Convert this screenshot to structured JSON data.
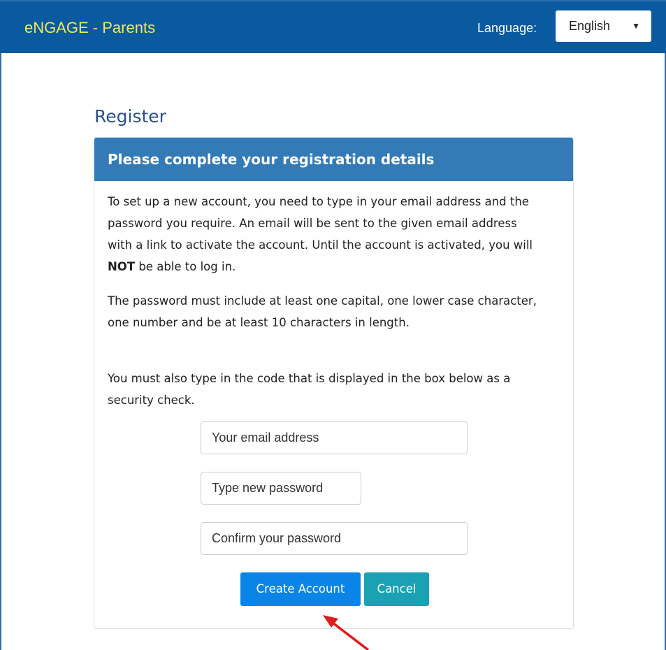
{
  "header": {
    "brand": "eNGAGE - Parents",
    "language_label": "Language:",
    "language_selected": "English"
  },
  "page": {
    "title": "Register"
  },
  "panel": {
    "heading": "Please complete your registration details",
    "para1_before": "To set up a new account, you need to type in your email address and the password you require. An email will be sent to the given email address with a link to activate the account. Until the account is activated, you will ",
    "para1_bold": "NOT",
    "para1_after": " be able to log in.",
    "para2": "The password must include at least one capital, one lower case character, one number and be at least 10 characters in length.",
    "para3": "You must also type in the code that is displayed in the box below as a security check."
  },
  "form": {
    "email_placeholder": "Your email address",
    "password_placeholder": "Type new password",
    "confirm_placeholder": "Confirm your password",
    "create_label": "Create Account",
    "cancel_label": "Cancel"
  },
  "colors": {
    "navbar_bg": "#0a5aa0",
    "brand_text": "#f3e85a",
    "panel_heading_bg": "#337ab7",
    "create_button": "#0b84e8",
    "cancel_button": "#1aa1b4",
    "annotation_arrow": "#e01b1b"
  },
  "icons": {
    "language_dropdown": "caret-down-icon",
    "annotation": "red-arrow-icon"
  }
}
